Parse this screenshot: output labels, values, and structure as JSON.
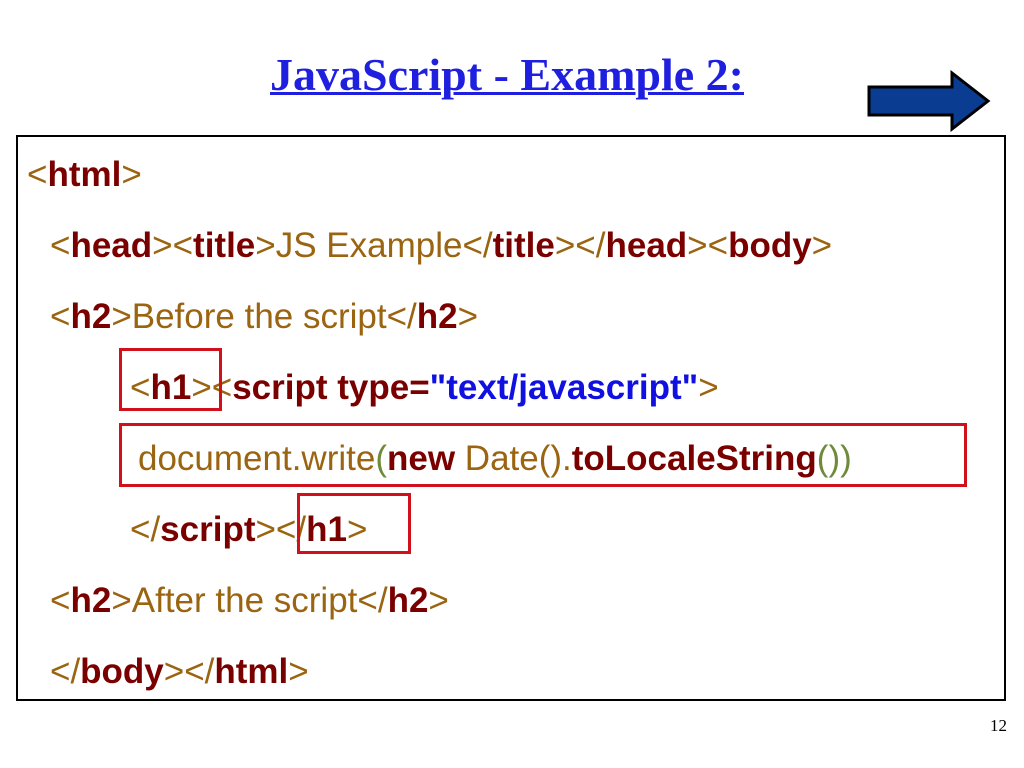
{
  "slide": {
    "title": "JavaScript - Example 2:",
    "page_number": "12",
    "next_icon": "right-arrow-icon",
    "colors": {
      "title": "#1f1fe0",
      "tag": "#7a0000",
      "bracket": "#9a6410",
      "string": "#1010e0",
      "highlight": "#d0101a",
      "arrow": "#0a3d91"
    }
  },
  "code": [
    {
      "segments": [
        {
          "t": "<",
          "c": "br"
        },
        {
          "t": "html",
          "c": "tag"
        },
        {
          "t": ">",
          "c": "br"
        }
      ]
    },
    {
      "segments": [
        {
          "t": "<",
          "c": "br"
        },
        {
          "t": "head",
          "c": "tag"
        },
        {
          "t": "><",
          "c": "br"
        },
        {
          "t": "title",
          "c": "tag"
        },
        {
          "t": ">JS Example</",
          "c": "txt"
        },
        {
          "t": "title",
          "c": "tag"
        },
        {
          "t": "></",
          "c": "br"
        },
        {
          "t": "head",
          "c": "tag"
        },
        {
          "t": "><",
          "c": "br"
        },
        {
          "t": "body",
          "c": "tag"
        },
        {
          "t": ">",
          "c": "br"
        }
      ]
    },
    {
      "segments": [
        {
          "t": "<",
          "c": "br"
        },
        {
          "t": "h2",
          "c": "tag"
        },
        {
          "t": ">Before the script</",
          "c": "txt"
        },
        {
          "t": "h2",
          "c": "tag"
        },
        {
          "t": ">",
          "c": "br"
        }
      ]
    },
    {
      "segments": [
        {
          "t": "<",
          "c": "br"
        },
        {
          "t": "h1",
          "c": "tag"
        },
        {
          "t": "><",
          "c": "br"
        },
        {
          "t": "script type=",
          "c": "tag"
        },
        {
          "t": "\"text/javascript\"",
          "c": "str"
        },
        {
          "t": ">",
          "c": "br"
        }
      ]
    },
    {
      "segments": [
        {
          "t": "document.write",
          "c": "txt"
        },
        {
          "t": "(",
          "c": "par"
        },
        {
          "t": "new",
          "c": "kw"
        },
        {
          "t": " Date().",
          "c": "txt"
        },
        {
          "t": "toLocaleString",
          "c": "kw"
        },
        {
          "t": "())",
          "c": "par"
        }
      ]
    },
    {
      "segments": [
        {
          "t": "</",
          "c": "br"
        },
        {
          "t": "script",
          "c": "tag"
        },
        {
          "t": "></",
          "c": "br"
        },
        {
          "t": "h1",
          "c": "tag"
        },
        {
          "t": ">",
          "c": "br"
        }
      ]
    },
    {
      "segments": [
        {
          "t": "<",
          "c": "br"
        },
        {
          "t": "h2",
          "c": "tag"
        },
        {
          "t": ">After the script</",
          "c": "txt"
        },
        {
          "t": "h2",
          "c": "tag"
        },
        {
          "t": ">",
          "c": "br"
        }
      ]
    },
    {
      "segments": [
        {
          "t": "</",
          "c": "br"
        },
        {
          "t": "body",
          "c": "tag"
        },
        {
          "t": "></",
          "c": "br"
        },
        {
          "t": "html",
          "c": "tag"
        },
        {
          "t": ">",
          "c": "br"
        }
      ]
    }
  ]
}
